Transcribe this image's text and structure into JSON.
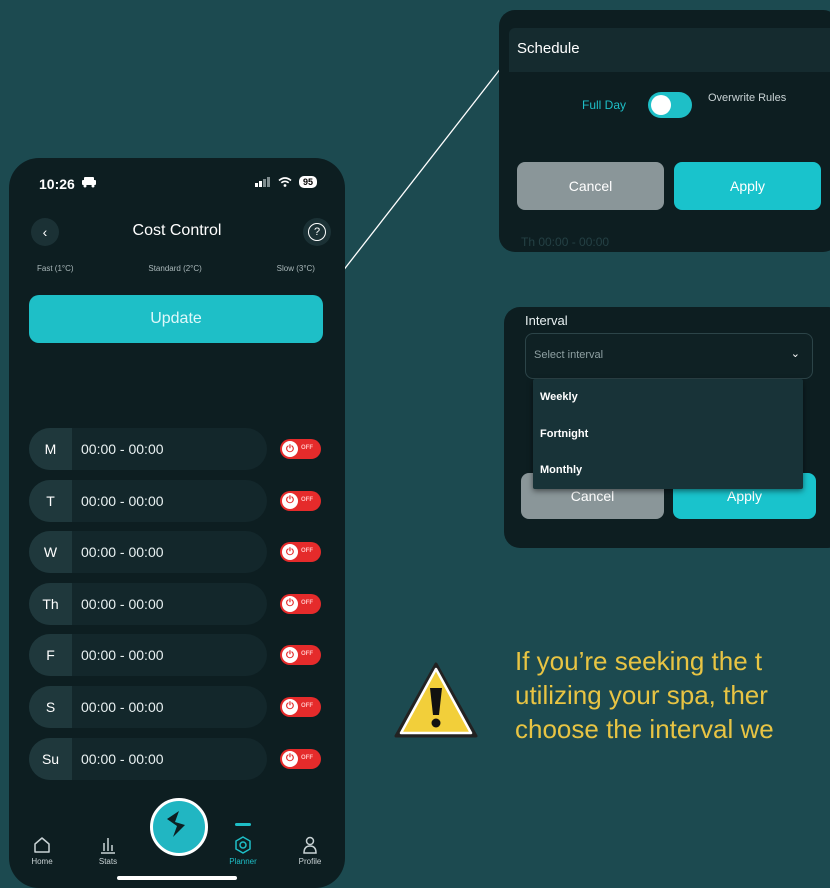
{
  "status_bar": {
    "time": "10:26",
    "battery": "95"
  },
  "header": {
    "title": "Cost Control"
  },
  "speeds": [
    "Fast (1°C)",
    "Standard (2°C)",
    "Slow (3°C)"
  ],
  "update_label": "Update",
  "days": [
    {
      "label": "M",
      "time": "00:00 - 00:00",
      "state": "OFF"
    },
    {
      "label": "T",
      "time": "00:00 - 00:00",
      "state": "OFF"
    },
    {
      "label": "W",
      "time": "00:00 - 00:00",
      "state": "OFF"
    },
    {
      "label": "Th",
      "time": "00:00 - 00:00",
      "state": "OFF"
    },
    {
      "label": "F",
      "time": "00:00 - 00:00",
      "state": "OFF"
    },
    {
      "label": "S",
      "time": "00:00 - 00:00",
      "state": "OFF"
    },
    {
      "label": "Su",
      "time": "00:00 - 00:00",
      "state": "OFF"
    }
  ],
  "nav": {
    "home": "Home",
    "stats": "Stats",
    "planner": "Planner",
    "profile": "Profile"
  },
  "schedule": {
    "title": "Schedule",
    "full_day": "Full Day",
    "overwrite": "Overwrite Rules",
    "cancel": "Cancel",
    "apply": "Apply",
    "ghost_row": "Th    00:00 - 00:00"
  },
  "interval": {
    "label": "Interval",
    "placeholder": "Select interval",
    "options": [
      "Weekly",
      "Fortnight",
      "Monthly"
    ],
    "cancel": "Cancel",
    "apply": "Apply"
  },
  "warning": {
    "line1": "If you’re seeking the t",
    "line2": "utilizing your spa, ther",
    "line3": "choose the interval we"
  },
  "colors": {
    "accent": "#1ebfc7",
    "off": "#e52b2b",
    "warning": "#e8c443",
    "background": "#1c4a50"
  }
}
